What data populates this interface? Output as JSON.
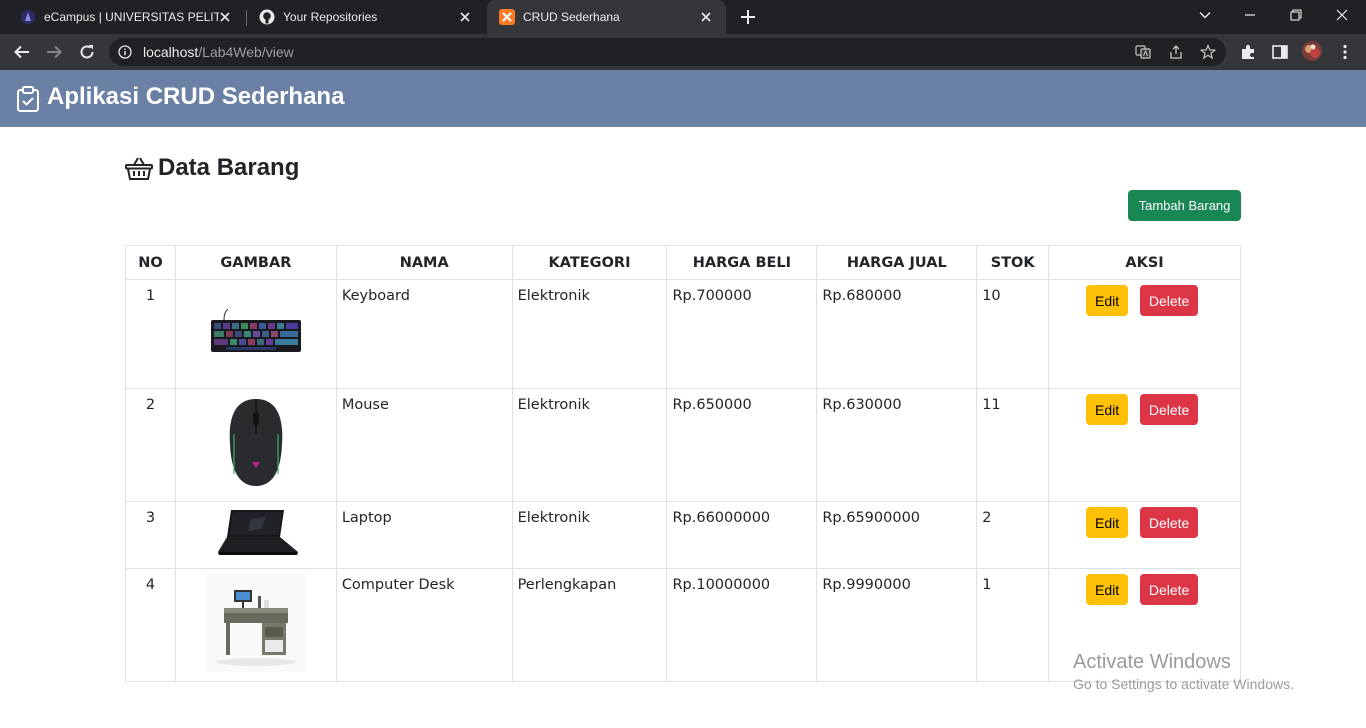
{
  "browser": {
    "tabs": [
      {
        "title": "eCampus | UNIVERSITAS PELITA B",
        "icon": "university-favicon-icon",
        "active": false
      },
      {
        "title": "Your Repositories",
        "icon": "github-icon",
        "active": false
      },
      {
        "title": "CRUD Sederhana",
        "icon": "xampp-icon",
        "active": true
      }
    ],
    "url_host": "localhost",
    "url_path": "/Lab4Web/view"
  },
  "app": {
    "brand": "Aplikasi CRUD Sederhana",
    "heading": "Data Barang",
    "add_button": "Tambah Barang"
  },
  "table": {
    "headers": [
      "NO",
      "GAMBAR",
      "NAMA",
      "KATEGORI",
      "HARGA BELI",
      "HARGA JUAL",
      "STOK",
      "AKSI"
    ],
    "rows": [
      {
        "no": "1",
        "image": "keyboard",
        "nama": "Keyboard",
        "kategori": "Elektronik",
        "harga_beli": "Rp.700000",
        "harga_jual": "Rp.680000",
        "stok": "10"
      },
      {
        "no": "2",
        "image": "mouse",
        "nama": "Mouse",
        "kategori": "Elektronik",
        "harga_beli": "Rp.650000",
        "harga_jual": "Rp.630000",
        "stok": "11"
      },
      {
        "no": "3",
        "image": "laptop",
        "nama": "Laptop",
        "kategori": "Elektronik",
        "harga_beli": "Rp.66000000",
        "harga_jual": "Rp.65900000",
        "stok": "2"
      },
      {
        "no": "4",
        "image": "computer-desk",
        "nama": "Computer Desk",
        "kategori": "Perlengkapan",
        "harga_beli": "Rp.10000000",
        "harga_jual": "Rp.9990000",
        "stok": "1"
      }
    ],
    "edit_label": "Edit",
    "delete_label": "Delete"
  },
  "watermark": {
    "line1": "Activate Windows",
    "line2": "Go to Settings to activate Windows."
  },
  "colors": {
    "appbar": "#6a80a4",
    "add_button": "#198754",
    "edit_button": "#ffc107",
    "delete_button": "#dc3545"
  }
}
